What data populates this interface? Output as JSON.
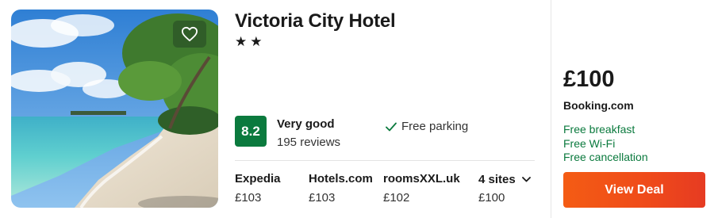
{
  "hotel": {
    "name": "Victoria City Hotel",
    "stars": "★★",
    "image_icon": "beach-photo",
    "favorite_icon": "heart-icon"
  },
  "rating": {
    "score": "8.2",
    "label": "Very good",
    "reviews": "195 reviews",
    "color": "#0b7a3e"
  },
  "amenities": [
    {
      "label": "Free parking",
      "icon": "check-icon"
    }
  ],
  "sites": [
    {
      "name": "Expedia",
      "price": "£103"
    },
    {
      "name": "Hotels.com",
      "price": "£103"
    },
    {
      "name": "roomsXXL.uk",
      "price": "£102"
    },
    {
      "name": "4 sites",
      "price": "£100"
    }
  ],
  "deal": {
    "price": "£100",
    "provider": "Booking.com",
    "perks": [
      "Free breakfast",
      "Free Wi-Fi",
      "Free cancellation"
    ],
    "button_label": "View Deal",
    "accent": "#ef4a1a",
    "perk_color": "#0b7a3e"
  }
}
